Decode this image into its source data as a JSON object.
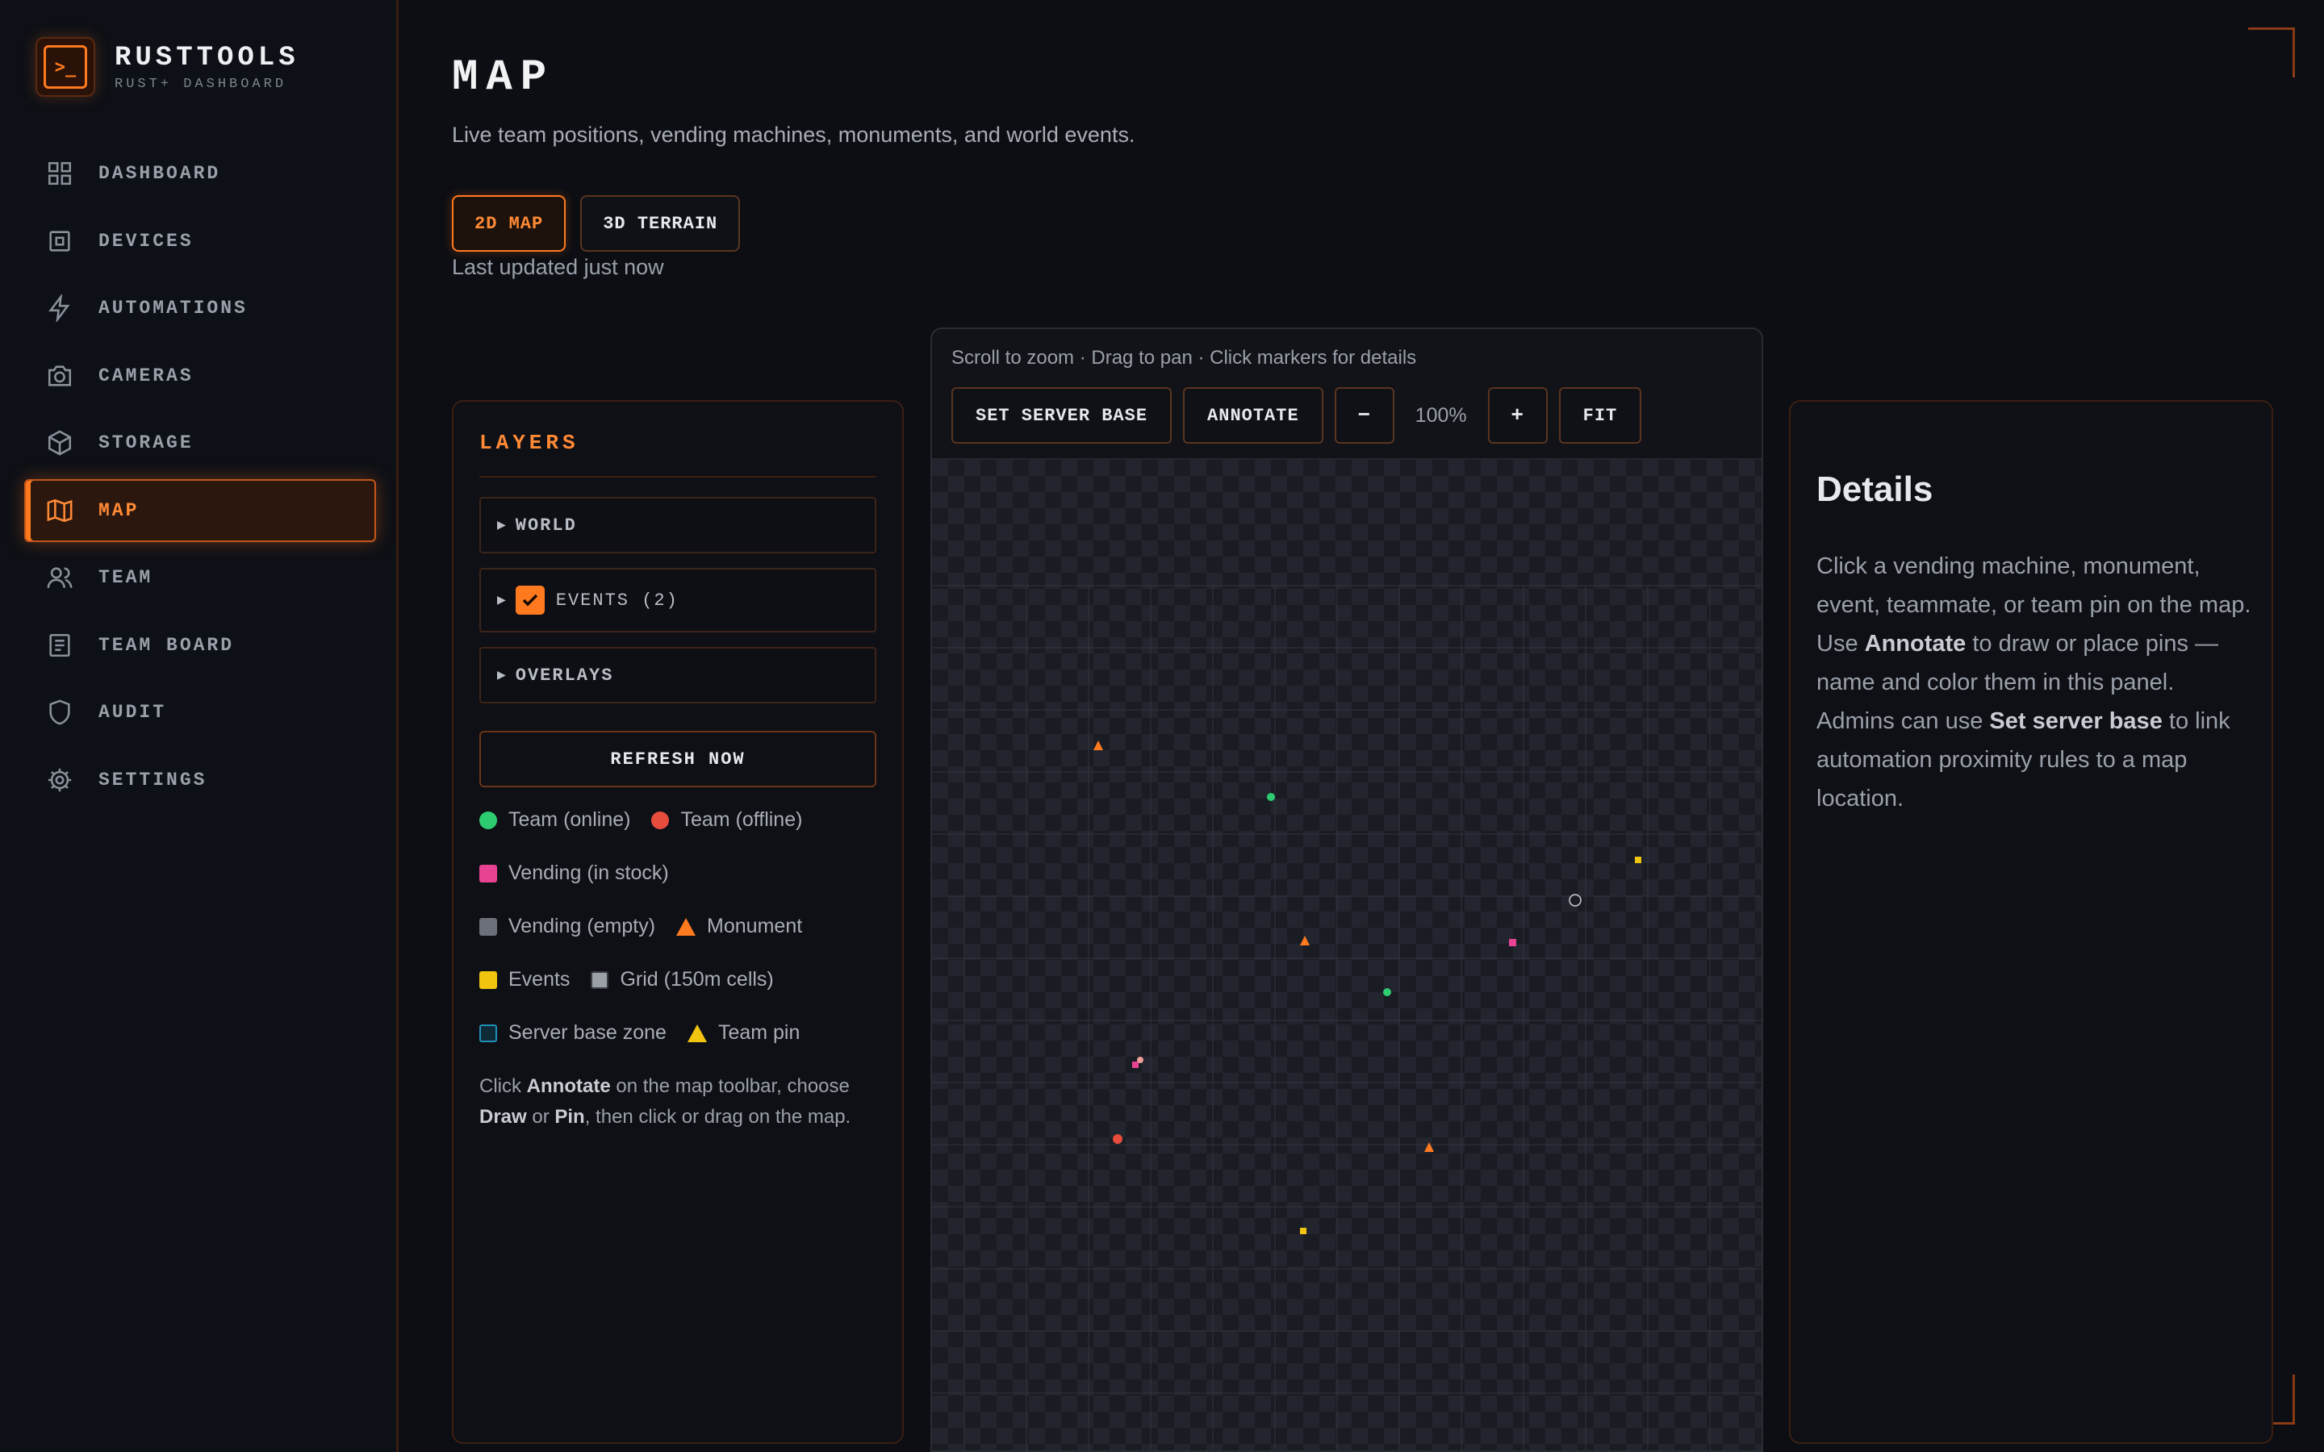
{
  "brand": {
    "title": "RUSTTOOLS",
    "subtitle": "RUST+ DASHBOARD"
  },
  "nav": [
    {
      "label": "DASHBOARD",
      "icon": "dashboard-icon"
    },
    {
      "label": "DEVICES",
      "icon": "device-icon"
    },
    {
      "label": "AUTOMATIONS",
      "icon": "lightning-icon"
    },
    {
      "label": "CAMERAS",
      "icon": "camera-icon"
    },
    {
      "label": "STORAGE",
      "icon": "box-icon"
    },
    {
      "label": "MAP",
      "icon": "map-icon",
      "active": true
    },
    {
      "label": "TEAM",
      "icon": "users-icon"
    },
    {
      "label": "TEAM BOARD",
      "icon": "board-icon"
    },
    {
      "label": "AUDIT",
      "icon": "shield-icon"
    },
    {
      "label": "SETTINGS",
      "icon": "gear-icon"
    }
  ],
  "page": {
    "title": "MAP",
    "subtitle": "Live team positions, vending machines, monuments, and world events.",
    "view_2d": "2D MAP",
    "view_3d": "3D TERRAIN",
    "updated": "Last updated just now"
  },
  "layers": {
    "title": "LAYERS",
    "world": "WORLD",
    "events": "EVENTS (2)",
    "overlays": "OVERLAYS",
    "refresh": "REFRESH NOW",
    "legend": {
      "team_online": "Team (online)",
      "team_offline": "Team (offline)",
      "vending_stock": "Vending (in stock)",
      "vending_empty": "Vending (empty)",
      "monument": "Monument",
      "events": "Events",
      "grid": "Grid (150m cells)",
      "server_base": "Server base zone",
      "team_pin": "Team pin"
    },
    "hint": {
      "p1": "Click ",
      "b1": "Annotate",
      "p2": " on the map toolbar, choose ",
      "b2": "Draw",
      "p3": " or ",
      "b3": "Pin",
      "p4": ", then click or drag on the map."
    }
  },
  "map": {
    "hint": "Scroll to zoom · Drag to pan · Click markers for details",
    "set_base": "SET SERVER BASE",
    "annotate": "ANNOTATE",
    "zoom_out": "−",
    "zoom": "100%",
    "zoom_in": "+",
    "fit": "FIT"
  },
  "details": {
    "title": "Details",
    "p1": "Click a vending machine, monument, event, teammate, or team pin on the map. Use ",
    "b1": "Annotate",
    "p2": " to draw or place pins — name and color them in this panel. Admins can use ",
    "b2": "Set server base",
    "p3": " to link automation proximity rules to a map location."
  },
  "colors": {
    "accent": "#ff7a1f",
    "team_online": "#2ecc71",
    "team_offline": "#e74c3c",
    "vending_stock": "#e84393",
    "vending_empty": "#6b6f78",
    "events": "#f1c40f",
    "grid": "#9aa0a6",
    "server_base": "#1f8fb8",
    "team_pin": "#f1c40f"
  }
}
